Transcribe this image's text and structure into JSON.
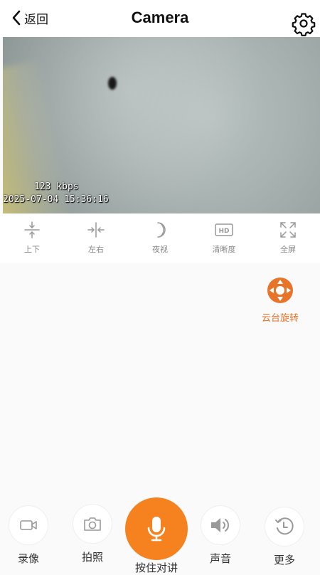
{
  "header": {
    "back_label": "返回",
    "title": "Camera"
  },
  "video": {
    "bitrate": "123 kbps",
    "timestamp": "2025-07-04 15:36:16"
  },
  "controls": [
    {
      "label": "上下",
      "icon": "flip-vertical-icon"
    },
    {
      "label": "左右",
      "icon": "flip-horizontal-icon"
    },
    {
      "label": "夜视",
      "icon": "moon-icon"
    },
    {
      "label": "清晰度",
      "icon": "hd-icon"
    },
    {
      "label": "全屏",
      "icon": "fullscreen-icon"
    }
  ],
  "ptz": {
    "label": "云台旋转",
    "icon": "ptz-direction-icon",
    "color": "#e8742a"
  },
  "bottom": {
    "record": "录像",
    "snapshot": "拍照",
    "talk": "按住对讲",
    "sound": "声音",
    "more": "更多"
  },
  "colors": {
    "accent": "#f5821f"
  }
}
